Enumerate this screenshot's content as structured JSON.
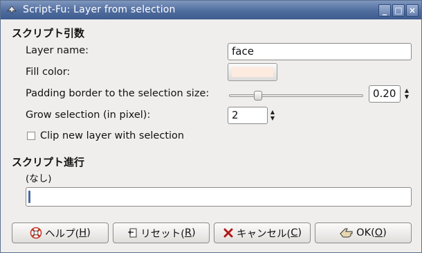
{
  "window": {
    "title": "Script-Fu: Layer from selection",
    "controls": [
      "_",
      "□",
      "×"
    ]
  },
  "args_section": {
    "title": "スクリプト引数",
    "layer_name_label": "Layer name:",
    "layer_name_value": "face",
    "fill_color_label": "Fill color:",
    "fill_color_value": "#fdebe0",
    "padding_label": "Padding border to the selection size:",
    "padding_value": "0.20",
    "padding_level_fraction": 0.2,
    "grow_label": "Grow selection (in pixel):",
    "grow_value": "2",
    "clip_label": "Clip new layer with selection",
    "clip_checked": false
  },
  "progress_section": {
    "title": "スクリプト進行",
    "status": "(なし)"
  },
  "buttons": {
    "help": {
      "label": "ヘルプ(",
      "mnemonic": "H",
      "close": ")"
    },
    "reset": {
      "label": "リセット(",
      "mnemonic": "R",
      "close": ")"
    },
    "cancel": {
      "label": "キャンセル(",
      "mnemonic": "C",
      "close": ")"
    },
    "ok": {
      "label": "OK(",
      "mnemonic": "O",
      "close": ")"
    }
  },
  "icons": {
    "app": "script-fu-icon",
    "help": "lifebuoy-icon",
    "reset": "reset-icon",
    "cancel": "cancel-x-icon",
    "ok": "ok-hand-icon"
  }
}
